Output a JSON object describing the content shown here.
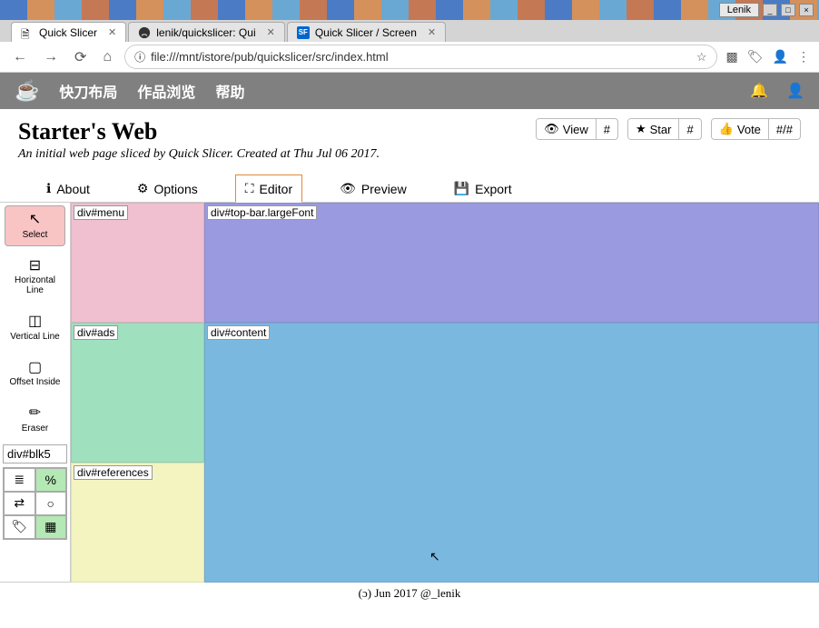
{
  "os": {
    "window_label": "Lenik",
    "buttons": [
      "min",
      "max",
      "close"
    ]
  },
  "browser": {
    "tabs": [
      {
        "title": "Quick Slicer",
        "active": true,
        "favicon": "page"
      },
      {
        "title": "lenik/quickslicer: Qui",
        "active": false,
        "favicon": "github"
      },
      {
        "title": "Quick Slicer / Screen",
        "active": false,
        "favicon": "sf"
      }
    ],
    "address": "file:///mnt/istore/pub/quickslicer/src/index.html",
    "addr_scheme_icon": "ⓘ",
    "extensions": [
      "qr",
      "tag",
      "user",
      "menu"
    ]
  },
  "app": {
    "nav": [
      "快刀布局",
      "作品浏览",
      "帮助"
    ],
    "right_icons": [
      "bell",
      "user"
    ]
  },
  "project": {
    "title": "Starter's Web",
    "subtitle": "An initial web page sliced by Quick Slicer. Created at Thu Jul 06 2017."
  },
  "stats": [
    {
      "icon": "👁",
      "label": "View",
      "count": "#"
    },
    {
      "icon": "★",
      "label": "Star",
      "count": "#"
    },
    {
      "icon": "👍",
      "label": "Vote",
      "count": "#/#"
    }
  ],
  "view_tabs": [
    {
      "icon": "ℹ",
      "label": "About",
      "active": false
    },
    {
      "icon": "⚙",
      "label": "Options",
      "active": false
    },
    {
      "icon": "⛶",
      "label": "Editor",
      "active": true
    },
    {
      "icon": "👁",
      "label": "Preview",
      "active": false
    },
    {
      "icon": "💾",
      "label": "Export",
      "active": false
    }
  ],
  "tools": [
    {
      "icon": "↖",
      "label": "Select",
      "active": true
    },
    {
      "icon": "⊟",
      "label": "Horizontal Line",
      "active": false
    },
    {
      "icon": "◫",
      "label": "Vertical Line",
      "active": false
    },
    {
      "icon": "▢",
      "label": "Offset Inside",
      "active": false
    },
    {
      "icon": "✏",
      "label": "Eraser",
      "active": false
    }
  ],
  "selector_value": "div#blk5",
  "mini_toolbar": [
    {
      "glyph": "≣",
      "on": false
    },
    {
      "glyph": "%",
      "on": true
    },
    {
      "glyph": "⇄",
      "on": false
    },
    {
      "glyph": "○",
      "on": false
    },
    {
      "glyph": "🏷",
      "on": false
    },
    {
      "glyph": "▦",
      "on": true
    }
  ],
  "regions": {
    "menu": "div#menu",
    "ads": "div#ads",
    "refs": "div#references",
    "topbar": "div#top-bar.largeFont",
    "content": "div#content"
  },
  "footer": "(ɔ) Jun 2017 @_lenik"
}
